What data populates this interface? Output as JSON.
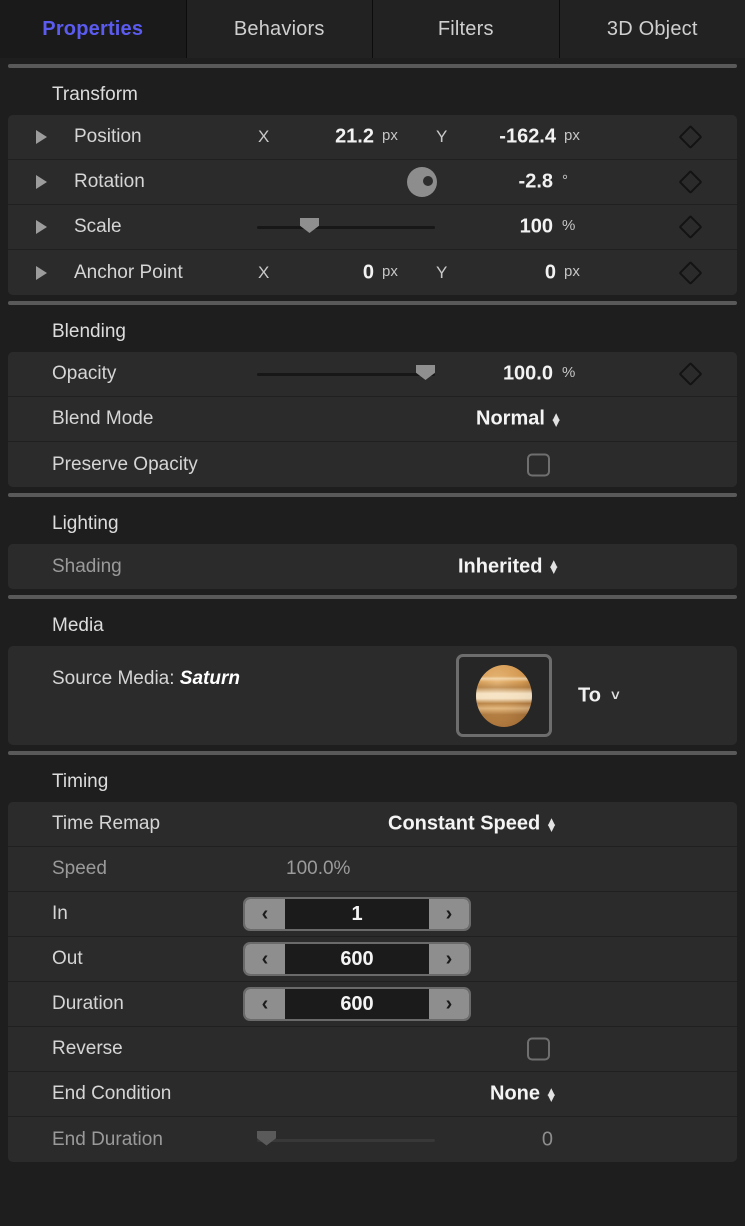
{
  "colors": {
    "accent": "#5b5bf0",
    "row_bg": "#2b2b2b",
    "page_bg": "#1e1e1e",
    "planet": "#d49a53"
  },
  "tabs": [
    {
      "label": "Properties",
      "active": true
    },
    {
      "label": "Behaviors",
      "active": false
    },
    {
      "label": "Filters",
      "active": false
    },
    {
      "label": "3D Object",
      "active": false
    }
  ],
  "sections": {
    "transform": {
      "title": "Transform",
      "position": {
        "label": "Position",
        "x_axis": "X",
        "x_value": "21.2",
        "x_unit": "px",
        "y_axis": "Y",
        "y_value": "-162.4",
        "y_unit": "px"
      },
      "rotation": {
        "label": "Rotation",
        "value": "-2.8",
        "unit": "°"
      },
      "scale": {
        "label": "Scale",
        "value": "100",
        "unit": "%",
        "slider_percent": 27
      },
      "anchor_point": {
        "label": "Anchor Point",
        "x_axis": "X",
        "x_value": "0",
        "x_unit": "px",
        "y_axis": "Y",
        "y_value": "0",
        "y_unit": "px"
      }
    },
    "blending": {
      "title": "Blending",
      "opacity": {
        "label": "Opacity",
        "value": "100.0",
        "unit": "%",
        "slider_percent": 100
      },
      "blend_mode": {
        "label": "Blend Mode",
        "value": "Normal"
      },
      "preserve_opacity": {
        "label": "Preserve Opacity",
        "checked": false
      }
    },
    "lighting": {
      "title": "Lighting",
      "shading": {
        "label": "Shading",
        "value": "Inherited"
      }
    },
    "media": {
      "title": "Media",
      "source_prefix": "Source Media:",
      "source_name": "Saturn",
      "to_label": "To"
    },
    "timing": {
      "title": "Timing",
      "time_remap": {
        "label": "Time Remap",
        "value": "Constant Speed"
      },
      "speed": {
        "label": "Speed",
        "value": "100.0%"
      },
      "in": {
        "label": "In",
        "value": "1"
      },
      "out": {
        "label": "Out",
        "value": "600"
      },
      "duration": {
        "label": "Duration",
        "value": "600"
      },
      "reverse": {
        "label": "Reverse",
        "checked": false
      },
      "end_condition": {
        "label": "End Condition",
        "value": "None"
      },
      "end_duration": {
        "label": "End Duration",
        "value": "0",
        "slider_percent": 0
      }
    }
  },
  "icons": {
    "stepper_prev": "‹",
    "stepper_next": "›",
    "popup_arrows_up": "▴",
    "popup_arrows_down": "▾",
    "chevron_down": "⌄"
  }
}
